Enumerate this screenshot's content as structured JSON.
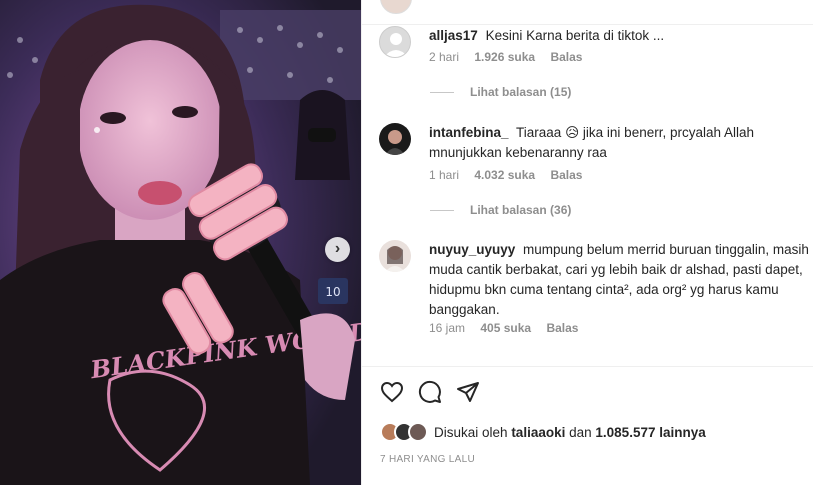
{
  "comments": [
    {
      "username": "alljas17",
      "text": "Kesini Karna berita di tiktok ...",
      "time": "2 hari",
      "likes": "1.926 suka",
      "reply": "Balas",
      "view_replies": "Lihat balasan (15)"
    },
    {
      "username": "intanfebina_",
      "text_a": "Tiaraaa",
      "emoji": "😥",
      "text_b": "jika ini benerr, prcyalah Allah mnunjukkan kebenaranny raa",
      "time": "1 hari",
      "likes": "4.032 suka",
      "reply": "Balas",
      "view_replies": "Lihat balasan (36)"
    },
    {
      "username": "nuyuy_uyuyy",
      "text": "mumpung belum merrid buruan tinggalin, masih muda cantik berbakat, cari yg lebih baik dr alshad, pasti dapet, hidupmu bkn cuma tentang cinta², ada org² yg harus kamu banggakan.",
      "time": "16 jam",
      "likes": "405 suka",
      "reply": "Balas"
    }
  ],
  "icons": [
    "heart-icon",
    "comment-icon",
    "share-icon",
    "chevron-right-icon"
  ],
  "liked_by": {
    "prefix": "Disukai oleh",
    "user": "taliaaoki",
    "joiner": "dan",
    "others": "1.085.577 lainnya"
  },
  "timestamp": "7 HARI YANG LALU",
  "photo": {
    "shirt_text": "BLACKPINK WORLD TOUR BORN PINK",
    "seat_label": "10"
  }
}
